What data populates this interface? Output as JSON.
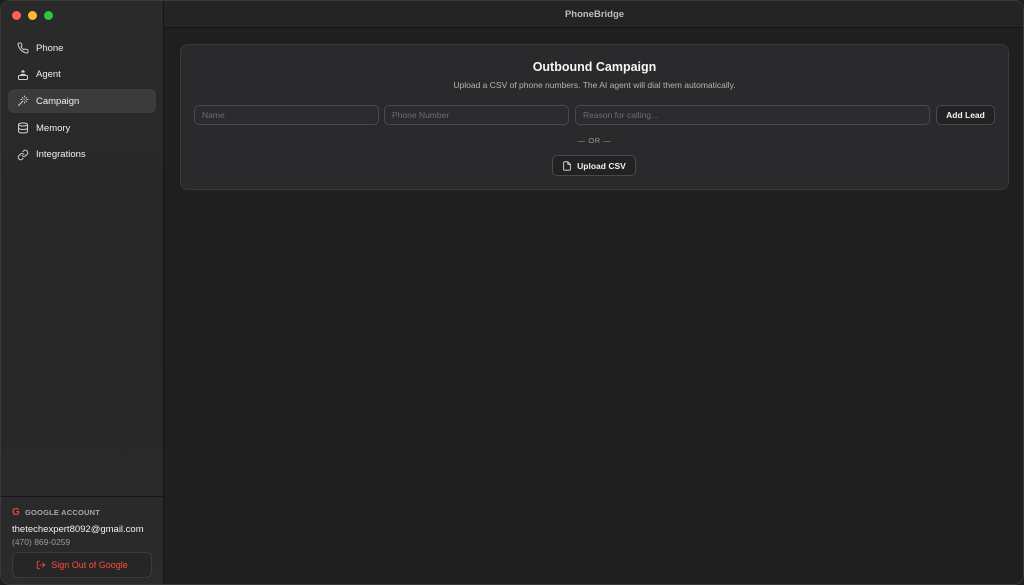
{
  "app": {
    "title": "PhoneBridge"
  },
  "sidebar": {
    "items": [
      {
        "label": "Phone",
        "icon": "phone-icon"
      },
      {
        "label": "Agent",
        "icon": "agent-icon"
      },
      {
        "label": "Campaign",
        "icon": "campaign-icon",
        "active": true
      },
      {
        "label": "Memory",
        "icon": "database-icon"
      },
      {
        "label": "Integrations",
        "icon": "link-icon"
      }
    ],
    "account": {
      "heading": "GOOGLE ACCOUNT",
      "logo": "G",
      "email": "thetechexpert8092@gmail.com",
      "phone": "(470) 869-0259",
      "signout_label": "Sign Out of Google"
    }
  },
  "campaign": {
    "title": "Outbound Campaign",
    "subtitle": "Upload a CSV of phone numbers. The AI agent will dial them automatically.",
    "name_placeholder": "Name",
    "phone_placeholder": "Phone Number",
    "reason_placeholder": "Reason for calling...",
    "add_label": "Add Lead",
    "or_text": "— OR —",
    "upload_label": "Upload CSV"
  },
  "colors": {
    "signout": "#ff4a3d",
    "active_nav": "#3b3b3b"
  }
}
